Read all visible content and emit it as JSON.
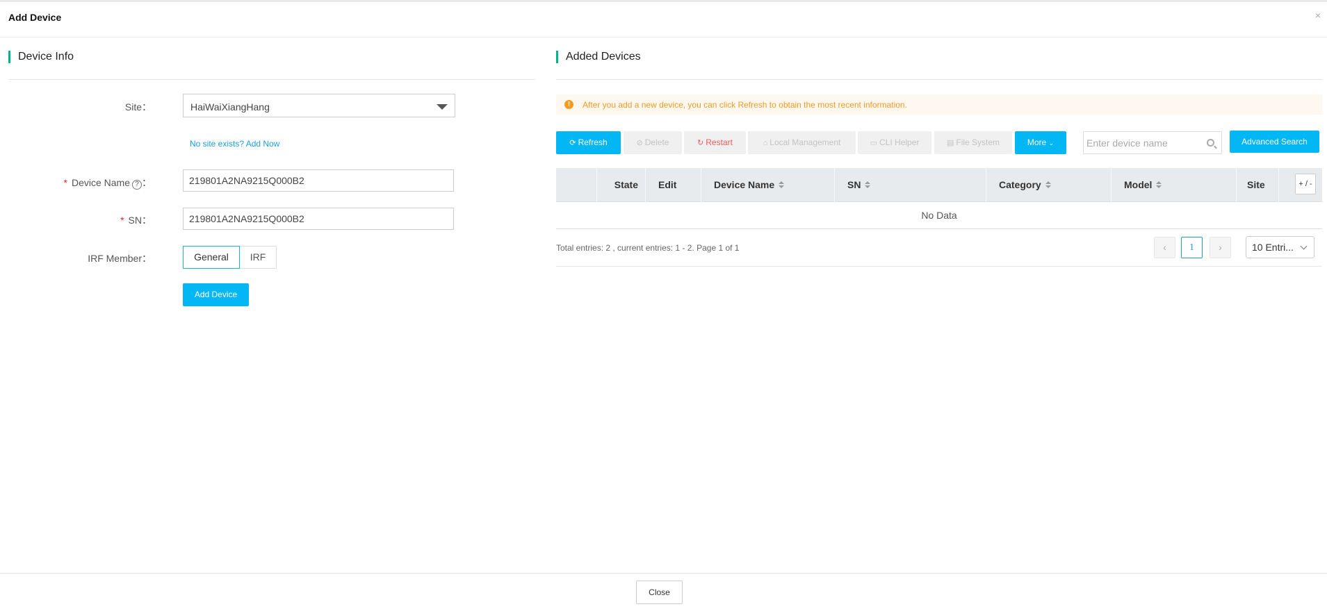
{
  "dialog": {
    "title": "Add Device",
    "close_glyph": "×"
  },
  "device_info": {
    "title": "Device Info",
    "site_label": "Site：",
    "site_value": "HaiWaiXiangHang",
    "no_site_link": "No site exists? Add Now",
    "device_name_label": "Device Name",
    "device_name_help": "?",
    "label_colon": "：",
    "device_name_value": "219801A2NA9215Q000B2",
    "sn_label": "SN：",
    "sn_value": "219801A2NA9215Q000B2",
    "required_mark": "*",
    "irf_member_label": "IRF Member：",
    "irf_options": [
      "General",
      "IRF"
    ],
    "irf_selected": "General",
    "add_device_button": "Add Device"
  },
  "added_devices": {
    "title": "Added Devices",
    "notice": "After you add a new device, you can click Refresh to obtain the most recent information.",
    "toolbar": {
      "refresh": "Refresh",
      "delete": "Delete",
      "restart": "Restart",
      "local_management": "Local Management",
      "cli_helper": "CLI Helper",
      "file_system": "File System",
      "more": "More"
    },
    "search_placeholder": "Enter device name",
    "advanced_search": "Advanced Search",
    "columns": [
      "State",
      "Edit",
      "Device Name",
      "SN",
      "Category",
      "Model",
      "Site"
    ],
    "column_toggle": "+ / -",
    "empty_text": "No Data",
    "pagination": {
      "info": "Total entries: 2 , current entries: 1 - 2. Page 1 of 1",
      "current_page": "1",
      "page_size": "10 Entri..."
    }
  },
  "footer": {
    "close_button": "Close"
  },
  "colors": {
    "accent": "#03b7f5",
    "section_bar": "#00b38a",
    "warning": "#f59a23",
    "danger": "#f05a5a"
  }
}
